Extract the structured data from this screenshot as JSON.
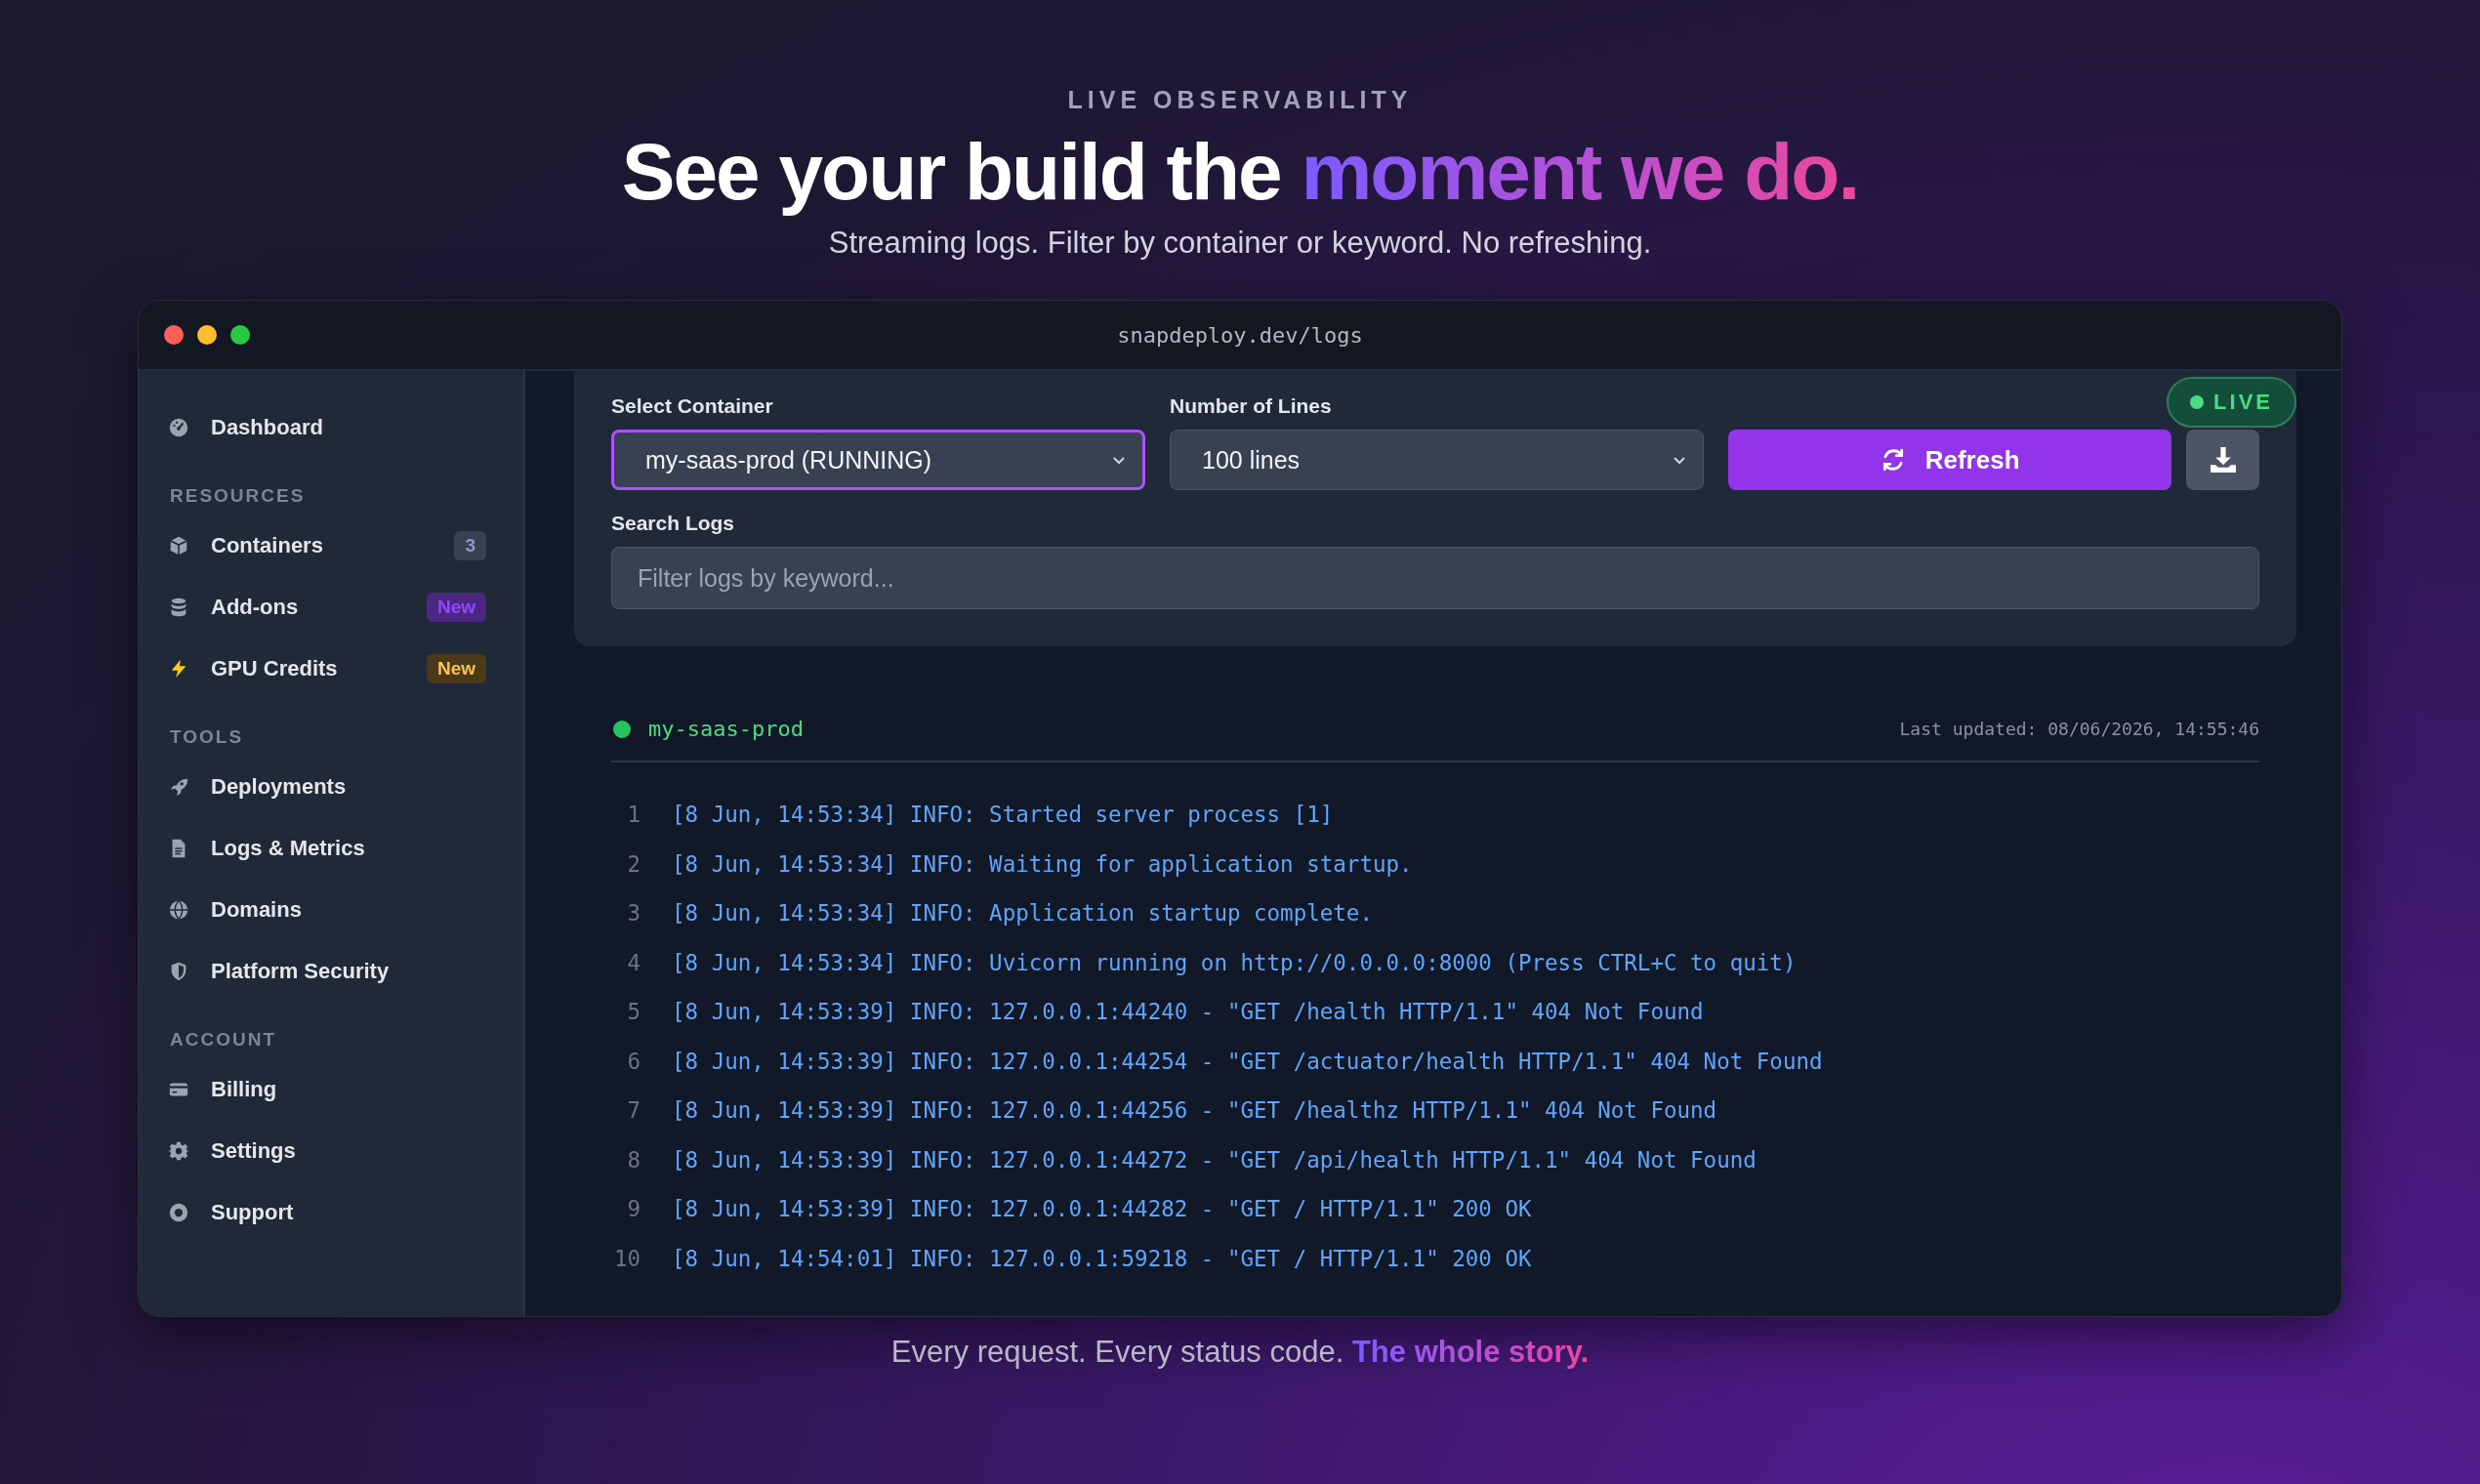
{
  "hero": {
    "eyebrow": "LIVE OBSERVABILITY",
    "headline": "See your build the",
    "headline_highlight": "moment we do.",
    "subtitle": "Streaming logs. Filter by container or keyword. No refreshing."
  },
  "window": {
    "url": "snapdeploy.dev/logs"
  },
  "sidebar": {
    "sections": [
      {
        "items": [
          {
            "label": "Dashboard",
            "selected": false
          }
        ]
      },
      {
        "title": "RESOURCES",
        "items": [
          {
            "label": "Containers",
            "selected": false,
            "badge": {
              "text": "3",
              "color": "#374151"
            }
          },
          {
            "label": "Add-ons",
            "selected": false,
            "badge": {
              "text": "New",
              "color": "#4b2782"
            }
          },
          {
            "label": "GPU Credits",
            "selected": false,
            "badge": {
              "text": "New",
              "color": "#4a3a1a"
            }
          }
        ]
      },
      {
        "title": "TOOLS",
        "items": [
          {
            "label": "Deployments",
            "selected": false
          },
          {
            "label": "Logs & Metrics",
            "selected": false
          },
          {
            "label": "Domains",
            "selected": false
          },
          {
            "label": "Platform Security",
            "selected": false
          }
        ]
      },
      {
        "title": "ACCOUNT",
        "items": [
          {
            "label": "Billing",
            "selected": false
          },
          {
            "label": "Settings",
            "selected": false
          },
          {
            "label": "Support",
            "selected": false
          }
        ]
      }
    ]
  },
  "controls": {
    "container_label": "Select Container",
    "container_value": "my-saas-prod (RUNNING)",
    "lines_label": "Number of Lines",
    "lines_value": "100 lines",
    "refresh": "Refresh",
    "live": "LIVE",
    "search_label": "Search Logs",
    "search": {
      "placeholder": "Filter logs by keyword..."
    }
  },
  "log": {
    "container": "my-saas-prod",
    "color": "#22c55e",
    "updated": "Last updated: 08/06/2026, 14:55:46",
    "lines": [
      {
        "number": "1",
        "text": "[8 Jun, 14:53:34] INFO: Started server process [1]"
      },
      {
        "number": "2",
        "text": "[8 Jun, 14:53:34] INFO: Waiting for application startup."
      },
      {
        "number": "3",
        "text": "[8 Jun, 14:53:34] INFO: Application startup complete."
      },
      {
        "number": "4",
        "text": "[8 Jun, 14:53:34] INFO: Uvicorn running on http://0.0.0.0:8000 (Press CTRL+C to quit)"
      },
      {
        "number": "5",
        "text": "[8 Jun, 14:53:39] INFO: 127.0.0.1:44240 - \"GET /health HTTP/1.1\" 404 Not Found"
      },
      {
        "number": "6",
        "text": "[8 Jun, 14:53:39] INFO: 127.0.0.1:44254 - \"GET /actuator/health HTTP/1.1\" 404 Not Found"
      },
      {
        "number": "7",
        "text": "[8 Jun, 14:53:39] INFO: 127.0.0.1:44256 - \"GET /healthz HTTP/1.1\" 404 Not Found"
      },
      {
        "number": "8",
        "text": "[8 Jun, 14:53:39] INFO: 127.0.0.1:44272 - \"GET /api/health HTTP/1.1\" 404 Not Found"
      },
      {
        "number": "9",
        "text": "[8 Jun, 14:53:39] INFO: 127.0.0.1:44282 - \"GET / HTTP/1.1\" 200 OK"
      },
      {
        "number": "10",
        "text": "[8 Jun, 14:54:01] INFO: 127.0.0.1:59218 - \"GET / HTTP/1.1\" 200 OK"
      }
    ]
  },
  "footer": {
    "text": "Every request. Every status code.",
    "highlight": "The whole story."
  }
}
